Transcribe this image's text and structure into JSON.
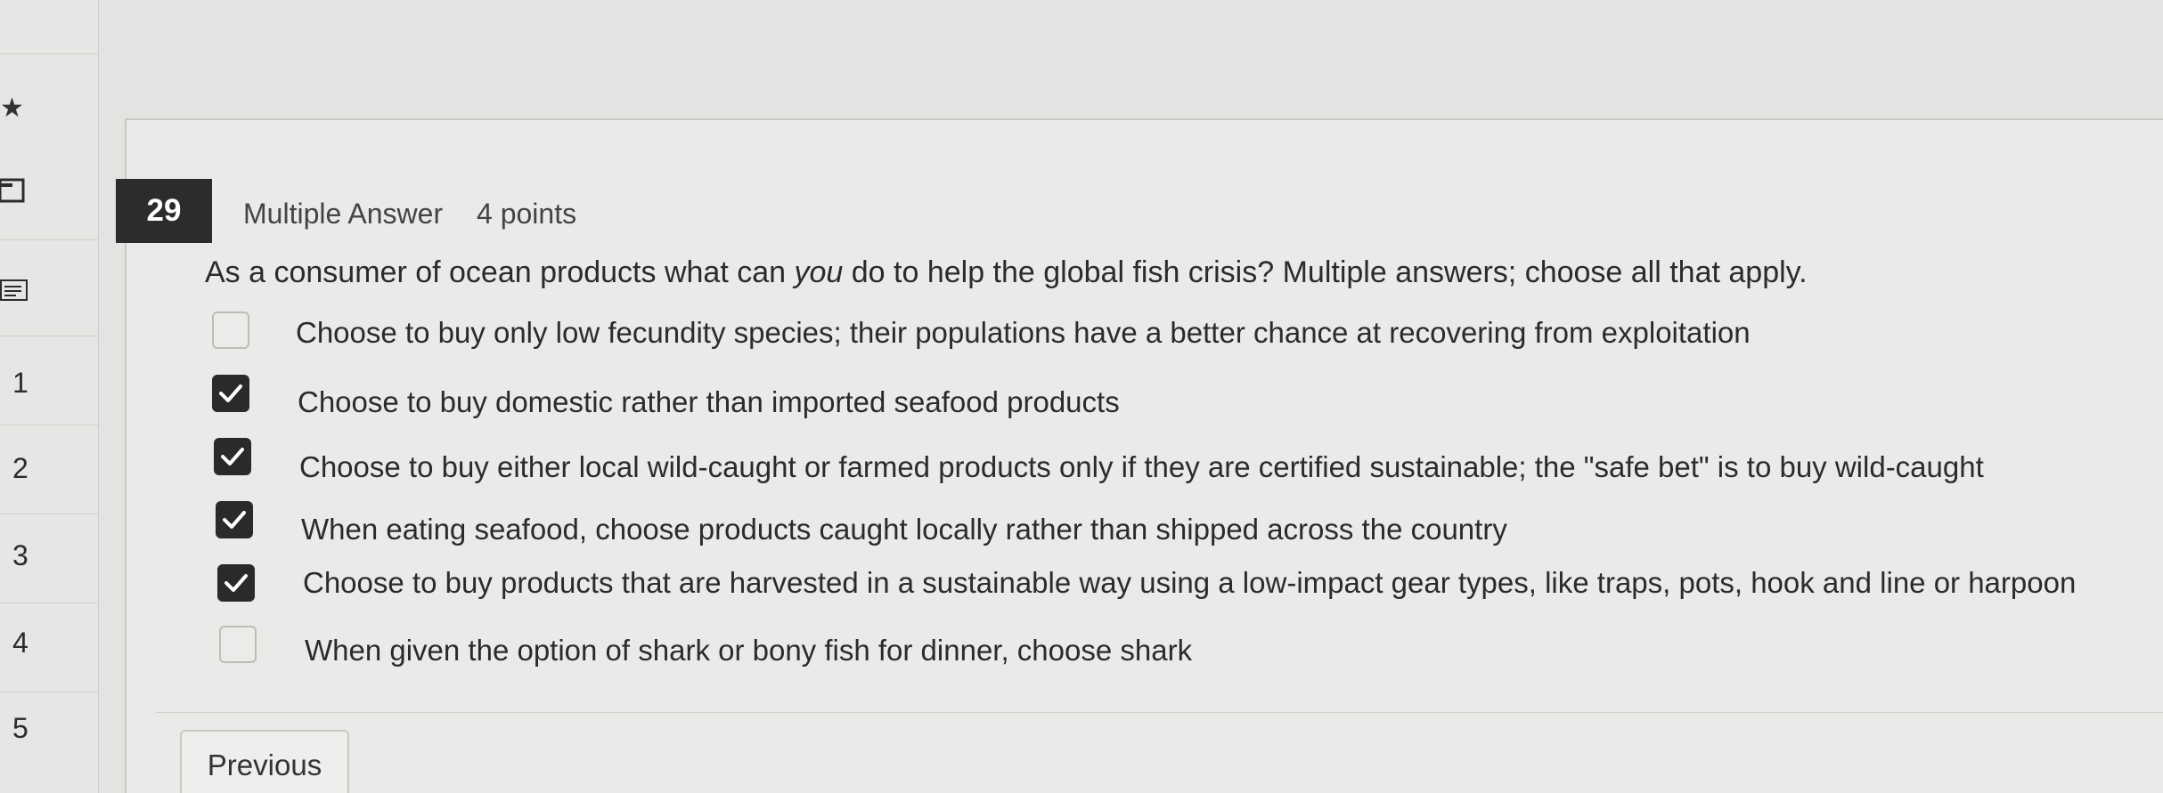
{
  "sidebar": {
    "items": [
      {
        "label": "1"
      },
      {
        "label": "2"
      },
      {
        "label": "3"
      },
      {
        "label": "4"
      },
      {
        "label": "5"
      }
    ]
  },
  "question": {
    "number": "29",
    "type": "Multiple Answer",
    "points": "4 points",
    "text_before": "As a consumer of ocean products what can ",
    "text_emph": "you",
    "text_after": " do to help the global fish crisis? Multiple answers; choose all that apply.",
    "options": [
      {
        "label": "Choose to buy only low fecundity species; their populations have a better chance at recovering from exploitation",
        "checked": false
      },
      {
        "label": "Choose to buy domestic rather than imported seafood products",
        "checked": true
      },
      {
        "label": "Choose to buy either local wild-caught or farmed products only if they are certified sustainable; the \"safe bet\" is to buy wild-caught",
        "checked": true
      },
      {
        "label": "When eating seafood, choose products caught locally rather than shipped across the country",
        "checked": true
      },
      {
        "label": "Choose to buy products that are harvested in a sustainable way using a low-impact gear types, like traps, pots, hook and line or harpoon",
        "checked": true
      },
      {
        "label": "When given the option of shark or bony fish for dinner, choose shark",
        "checked": false
      }
    ]
  },
  "nav": {
    "previous_label": "Previous"
  }
}
